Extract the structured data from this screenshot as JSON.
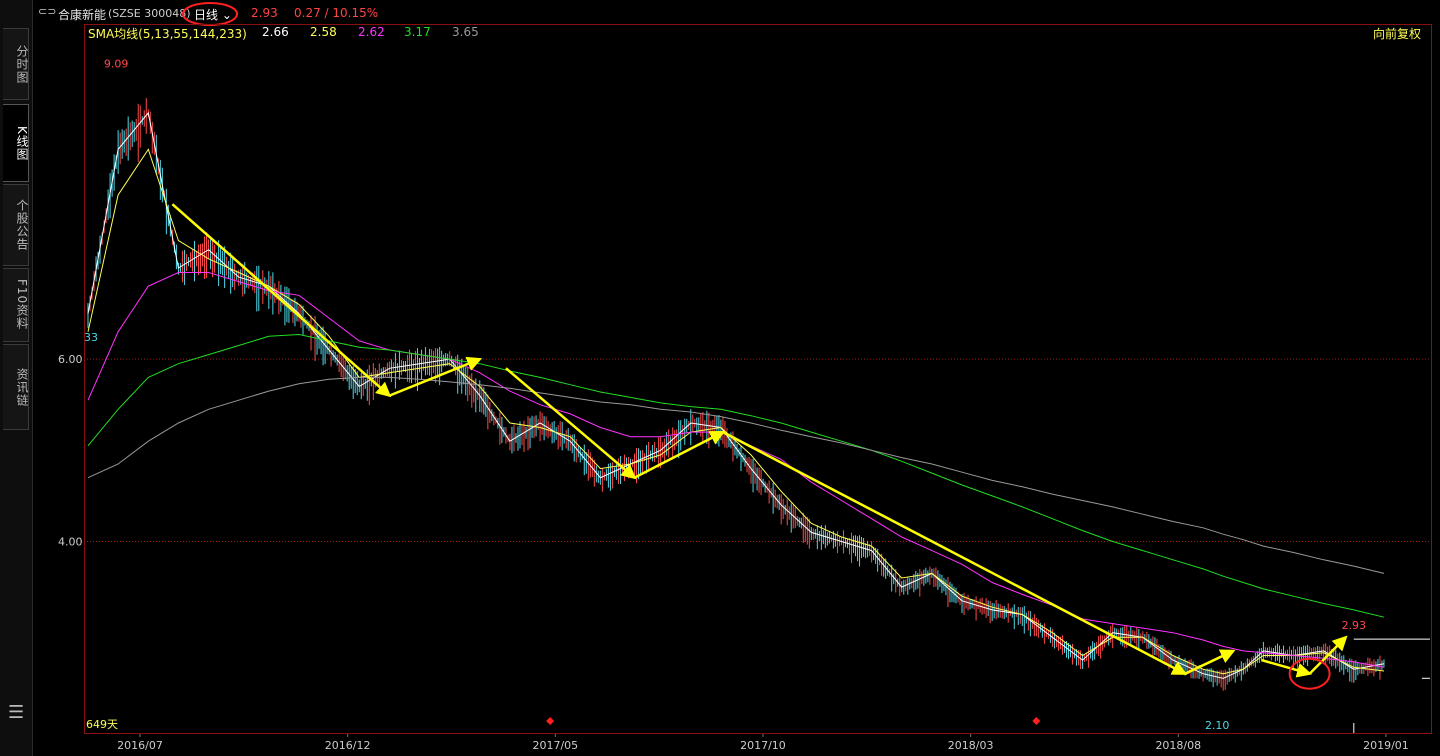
{
  "header": {
    "stock_name": "合康新能",
    "stock_code": "(SZSE 300048)",
    "period_label": "日线",
    "price": "2.93",
    "change": "0.27 / 10.15%",
    "adjust_label": "向前复权"
  },
  "sidebar": {
    "tabs": [
      {
        "label": "分时图"
      },
      {
        "label": "K线图"
      },
      {
        "label": "个股公告"
      },
      {
        "label": "F10资料"
      },
      {
        "label": "资讯链"
      }
    ]
  },
  "indicator": {
    "name": "SMA均线(5,13,55,144,233)",
    "values": [
      {
        "value": "2.66",
        "color": "#ffffff"
      },
      {
        "value": "2.58",
        "color": "#ffff55"
      },
      {
        "value": "2.62",
        "color": "#ff33ff"
      },
      {
        "value": "3.17",
        "color": "#22dd22"
      },
      {
        "value": "3.65",
        "color": "#999999"
      }
    ]
  },
  "chart_data": {
    "type": "line",
    "title": "",
    "x_tick_labels": [
      "2016/07",
      "2016/12",
      "2017/05",
      "2017/10",
      "2018/03",
      "2018/08",
      "2019/01"
    ],
    "y_tick_labels": [
      "6.00",
      "4.00"
    ],
    "ylim": [
      1.9,
      9.5
    ],
    "annotations": {
      "high": "9.09",
      "low": "2.10",
      "last": "2.93",
      "left_edge": "33",
      "day_count": "649天"
    },
    "series": [
      {
        "name": "5",
        "color": "#ffffff",
        "x": [
          0,
          15,
          30,
          45,
          60,
          75,
          90,
          105,
          120,
          135,
          150,
          165,
          180,
          195,
          210,
          225,
          240,
          255,
          270,
          285,
          300,
          315,
          330,
          345,
          360,
          375,
          390,
          405,
          420,
          435,
          450,
          465,
          480,
          495,
          510,
          525,
          540,
          555,
          565,
          575,
          585,
          600,
          615,
          630,
          645
        ],
        "y": [
          6.5,
          8.3,
          8.7,
          7.0,
          7.2,
          6.9,
          6.8,
          6.5,
          6.1,
          5.7,
          5.9,
          5.95,
          6.0,
          5.6,
          5.1,
          5.3,
          5.1,
          4.7,
          4.85,
          5.0,
          5.3,
          5.25,
          4.8,
          4.4,
          4.1,
          4.0,
          3.9,
          3.5,
          3.65,
          3.35,
          3.25,
          3.2,
          2.95,
          2.7,
          3.0,
          2.95,
          2.7,
          2.55,
          2.5,
          2.6,
          2.8,
          2.75,
          2.8,
          2.6,
          2.66
        ]
      },
      {
        "name": "13",
        "color": "#ffff55",
        "x": [
          0,
          15,
          30,
          45,
          60,
          75,
          90,
          105,
          120,
          135,
          150,
          165,
          180,
          195,
          210,
          225,
          240,
          255,
          270,
          285,
          300,
          315,
          330,
          345,
          360,
          375,
          390,
          405,
          420,
          435,
          450,
          465,
          480,
          495,
          510,
          525,
          540,
          555,
          565,
          575,
          585,
          600,
          615,
          630,
          645
        ],
        "y": [
          6.3,
          7.8,
          8.3,
          7.3,
          7.1,
          6.95,
          6.8,
          6.6,
          6.25,
          5.8,
          5.85,
          5.9,
          5.95,
          5.7,
          5.3,
          5.25,
          5.15,
          4.8,
          4.85,
          4.95,
          5.2,
          5.25,
          4.95,
          4.55,
          4.2,
          4.05,
          3.95,
          3.6,
          3.65,
          3.4,
          3.28,
          3.2,
          3.0,
          2.75,
          2.95,
          2.95,
          2.75,
          2.6,
          2.55,
          2.6,
          2.75,
          2.75,
          2.78,
          2.62,
          2.58
        ]
      },
      {
        "name": "55",
        "color": "#ff33ff",
        "x": [
          0,
          15,
          30,
          45,
          60,
          75,
          90,
          105,
          120,
          135,
          150,
          165,
          180,
          195,
          210,
          225,
          240,
          255,
          270,
          285,
          300,
          315,
          330,
          345,
          360,
          375,
          390,
          405,
          420,
          435,
          450,
          465,
          480,
          495,
          510,
          525,
          540,
          555,
          565,
          575,
          585,
          600,
          615,
          630,
          645
        ],
        "y": [
          5.55,
          6.3,
          6.8,
          6.95,
          6.95,
          6.85,
          6.75,
          6.7,
          6.45,
          6.2,
          6.1,
          6.05,
          6.0,
          5.85,
          5.65,
          5.5,
          5.4,
          5.25,
          5.15,
          5.15,
          5.2,
          5.2,
          5.05,
          4.9,
          4.65,
          4.45,
          4.25,
          4.05,
          3.9,
          3.75,
          3.55,
          3.42,
          3.3,
          3.15,
          3.1,
          3.05,
          3.0,
          2.92,
          2.85,
          2.8,
          2.78,
          2.75,
          2.72,
          2.68,
          2.62
        ]
      },
      {
        "name": "144",
        "color": "#22dd22",
        "x": [
          0,
          15,
          30,
          45,
          60,
          75,
          90,
          105,
          120,
          135,
          150,
          165,
          180,
          195,
          210,
          225,
          240,
          255,
          270,
          285,
          300,
          315,
          330,
          345,
          360,
          375,
          390,
          405,
          420,
          435,
          450,
          465,
          480,
          495,
          510,
          525,
          540,
          555,
          565,
          575,
          585,
          600,
          615,
          630,
          645
        ],
        "y": [
          5.05,
          5.45,
          5.8,
          5.95,
          6.05,
          6.15,
          6.25,
          6.27,
          6.2,
          6.13,
          6.1,
          6.05,
          6.0,
          5.95,
          5.87,
          5.8,
          5.72,
          5.64,
          5.58,
          5.52,
          5.48,
          5.45,
          5.38,
          5.3,
          5.2,
          5.1,
          5.0,
          4.88,
          4.75,
          4.62,
          4.5,
          4.38,
          4.25,
          4.12,
          4.0,
          3.9,
          3.8,
          3.7,
          3.62,
          3.55,
          3.48,
          3.4,
          3.32,
          3.25,
          3.17
        ]
      },
      {
        "name": "233",
        "color": "#999999",
        "x": [
          0,
          15,
          30,
          45,
          60,
          75,
          90,
          105,
          120,
          135,
          150,
          165,
          180,
          195,
          210,
          225,
          240,
          255,
          270,
          285,
          300,
          315,
          330,
          345,
          360,
          375,
          390,
          405,
          420,
          435,
          450,
          465,
          480,
          495,
          510,
          525,
          540,
          555,
          565,
          575,
          585,
          600,
          615,
          630,
          645
        ],
        "y": [
          4.7,
          4.85,
          5.1,
          5.3,
          5.45,
          5.55,
          5.65,
          5.73,
          5.78,
          5.8,
          5.8,
          5.78,
          5.75,
          5.72,
          5.68,
          5.63,
          5.58,
          5.53,
          5.5,
          5.45,
          5.42,
          5.37,
          5.3,
          5.22,
          5.15,
          5.08,
          5.0,
          4.92,
          4.85,
          4.76,
          4.67,
          4.6,
          4.52,
          4.45,
          4.38,
          4.3,
          4.22,
          4.15,
          4.08,
          4.02,
          3.95,
          3.88,
          3.8,
          3.73,
          3.65
        ]
      }
    ],
    "trend_arrows": [
      {
        "from": [
          42,
          7.7
        ],
        "to": [
          150,
          5.6
        ]
      },
      {
        "from": [
          150,
          5.6
        ],
        "to": [
          195,
          6.0
        ]
      },
      {
        "from": [
          208,
          5.9
        ],
        "to": [
          272,
          4.7
        ]
      },
      {
        "from": [
          272,
          4.7
        ],
        "to": [
          316,
          5.2
        ]
      },
      {
        "from": [
          316,
          5.2
        ],
        "to": [
          546,
          2.55
        ]
      },
      {
        "from": [
          546,
          2.55
        ],
        "to": [
          570,
          2.8
        ]
      },
      {
        "from": [
          584,
          2.7
        ],
        "to": [
          608,
          2.55
        ]
      },
      {
        "from": [
          608,
          2.55
        ],
        "to": [
          626,
          2.95
        ]
      }
    ]
  }
}
